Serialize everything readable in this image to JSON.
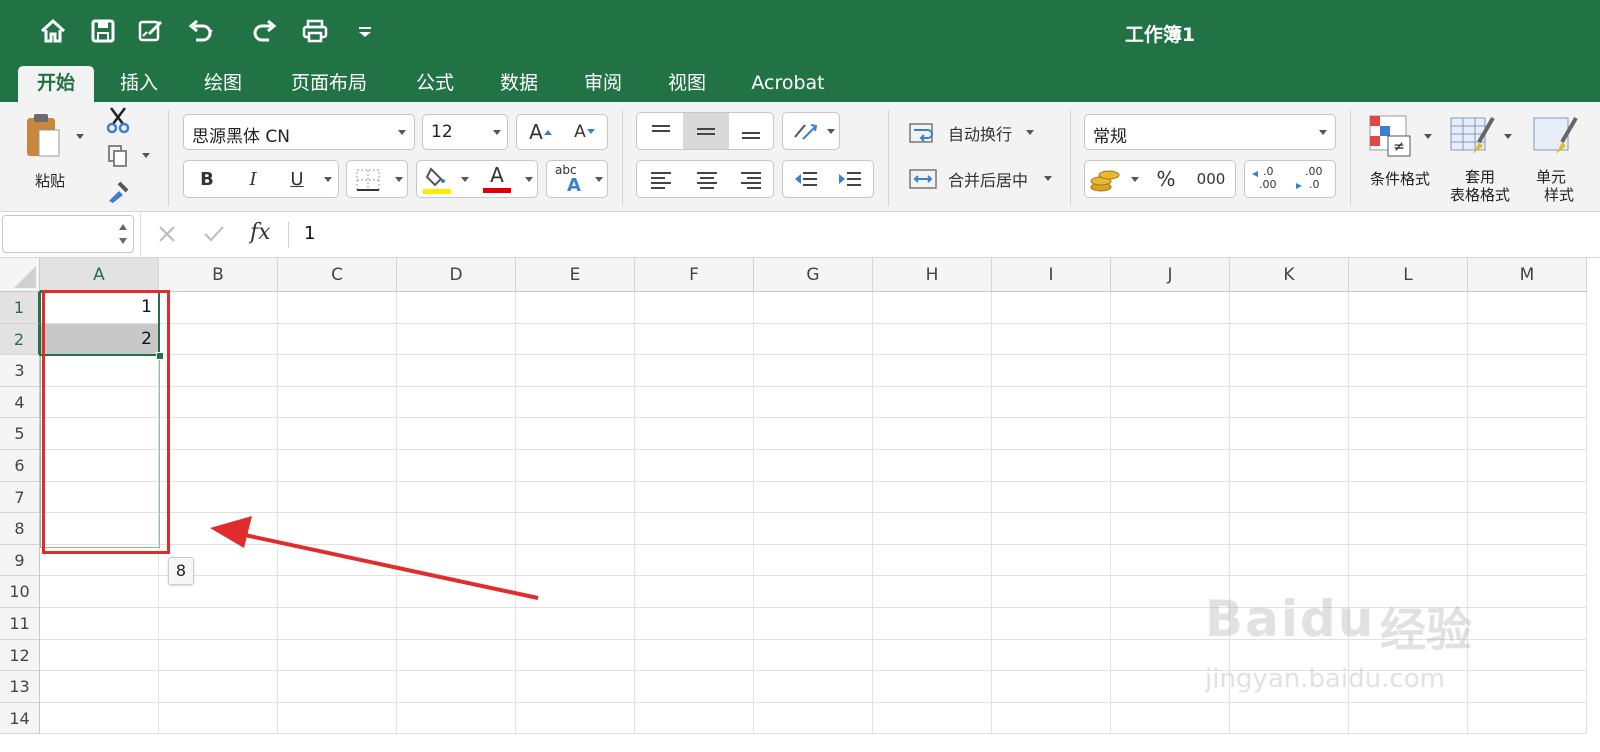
{
  "window": {
    "title": "工作簿1"
  },
  "tabs": [
    "开始",
    "插入",
    "绘图",
    "页面布局",
    "公式",
    "数据",
    "审阅",
    "视图",
    "Acrobat"
  ],
  "active_tab": "开始",
  "clipboard": {
    "paste_label": "粘贴"
  },
  "font": {
    "family": "思源黑体 CN",
    "size": "12",
    "bold": "B",
    "italic": "I",
    "underline": "U",
    "grow_a": "A",
    "shrink_a": "A",
    "font_color_a": "A",
    "phonetic_abc": "abc",
    "phonetic_a": "A"
  },
  "alignment": {
    "wrap_text": "自动换行",
    "merge_center": "合并后居中"
  },
  "number": {
    "format": "常规",
    "percent": "%",
    "comma": "000",
    "inc_decimal_top": ".0",
    "inc_decimal_bottom": ".00",
    "dec_decimal_top": ".00",
    "dec_decimal_bottom": ".0"
  },
  "styles": {
    "conditional_format": "条件格式",
    "table_format_line1": "套用",
    "table_format_line2": "表格格式",
    "cell_styles_line1": "单元",
    "cell_styles_line2": "样式"
  },
  "formula_bar": {
    "name_box": "",
    "fx": "fx",
    "value": "1"
  },
  "columns": [
    "A",
    "B",
    "C",
    "D",
    "E",
    "F",
    "G",
    "H",
    "I",
    "J",
    "K",
    "L",
    "M"
  ],
  "rows": [
    "1",
    "2",
    "3",
    "4",
    "5",
    "6",
    "7",
    "8",
    "9",
    "10",
    "11",
    "12",
    "13",
    "14"
  ],
  "cells": {
    "A1": "1",
    "A2": "2"
  },
  "fill_tooltip": "8",
  "watermark": {
    "brand": "Bai",
    "paw": "du",
    "suffix": "经验",
    "url": "jingyan.baidu.com"
  },
  "colors": {
    "excel_green": "#217346",
    "annotation_red": "#e02c2c",
    "highlight_yellow": "#ffeb00",
    "font_red": "#e00000"
  }
}
